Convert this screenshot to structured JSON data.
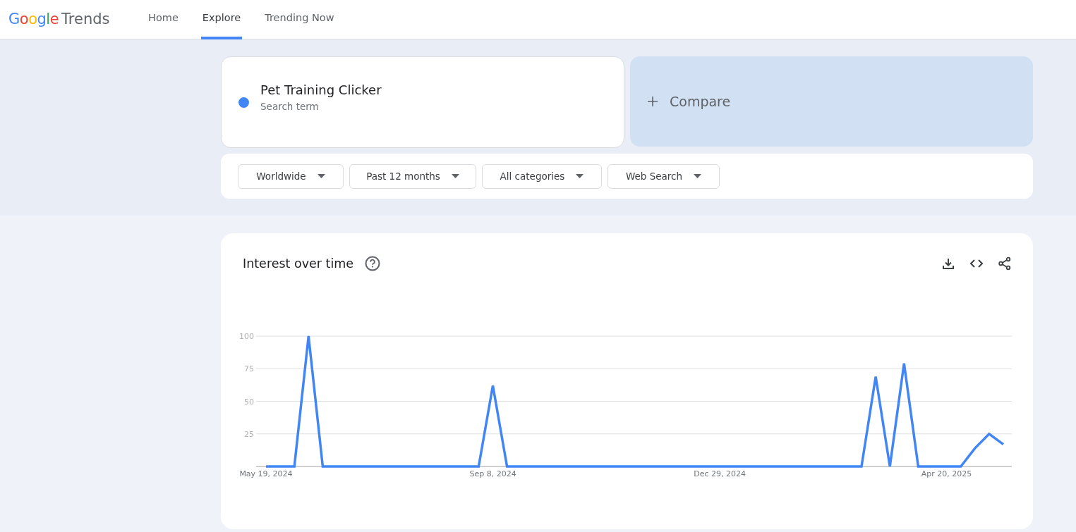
{
  "header": {
    "logo": {
      "brand": "Google",
      "product": "Trends"
    },
    "nav": [
      {
        "label": "Home",
        "selected": false
      },
      {
        "label": "Explore",
        "selected": true
      },
      {
        "label": "Trending Now",
        "selected": false
      }
    ]
  },
  "search_term": {
    "term": "Pet Training Clicker",
    "subtitle": "Search term",
    "color": "#4285f4"
  },
  "compare": {
    "label": "Compare"
  },
  "filters": [
    {
      "label": "Worldwide"
    },
    {
      "label": "Past 12 months"
    },
    {
      "label": "All categories"
    },
    {
      "label": "Web Search"
    }
  ],
  "interest_over_time": {
    "title": "Interest over time",
    "chart_data": {
      "type": "line",
      "categories": [
        "May 19, 2024",
        null,
        null,
        null,
        null,
        null,
        null,
        null,
        null,
        null,
        null,
        null,
        null,
        null,
        null,
        null,
        "Sep 8, 2024",
        null,
        null,
        null,
        null,
        null,
        null,
        null,
        null,
        null,
        null,
        null,
        null,
        null,
        null,
        null,
        "Dec 29, 2024",
        null,
        null,
        null,
        null,
        null,
        null,
        null,
        null,
        null,
        null,
        null,
        null,
        null,
        null,
        null,
        "Apr 20, 2025",
        null,
        null,
        null,
        null
      ],
      "series": [
        {
          "color": "#4285f4",
          "values": [
            0,
            0,
            0,
            100,
            0,
            0,
            0,
            0,
            0,
            0,
            0,
            0,
            0,
            0,
            0,
            0,
            62,
            0,
            0,
            0,
            0,
            0,
            0,
            0,
            0,
            0,
            0,
            0,
            0,
            0,
            0,
            0,
            0,
            0,
            0,
            0,
            0,
            0,
            0,
            0,
            0,
            0,
            0,
            69,
            0,
            79,
            0,
            0,
            0,
            0,
            14,
            25,
            17
          ]
        }
      ],
      "ylim": [
        0,
        100
      ],
      "grid": true,
      "yticks": [
        25,
        50,
        75,
        100
      ]
    }
  }
}
